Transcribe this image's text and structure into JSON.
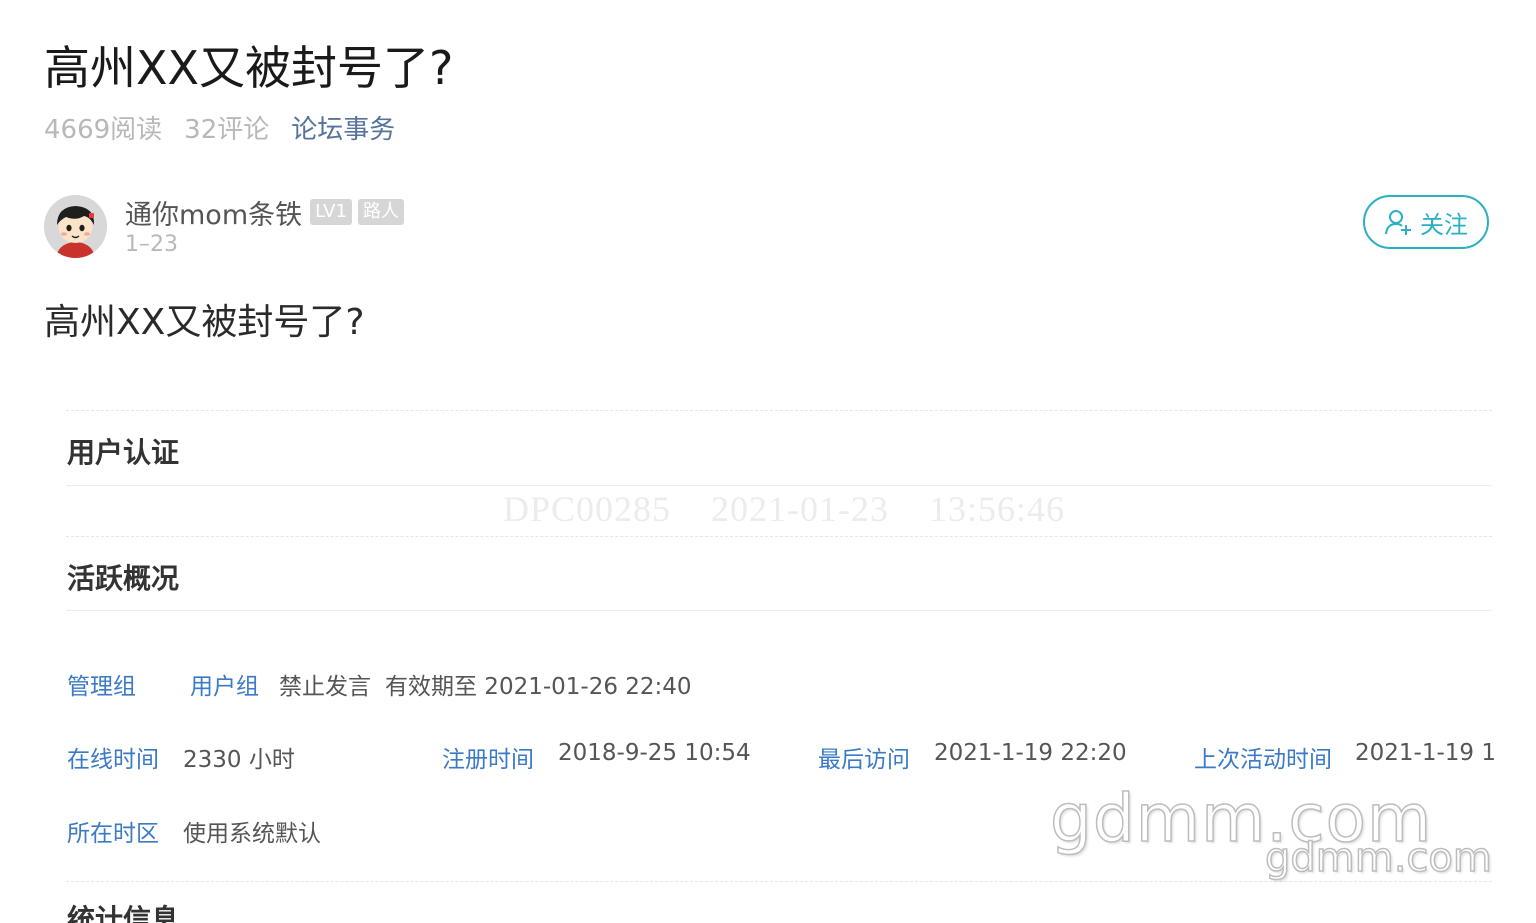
{
  "post": {
    "title": "高州XX又被封号了?",
    "body": "高州XX又被封号了?"
  },
  "meta": {
    "reads": "4669阅读",
    "comments": "32评论",
    "category": "论坛事务"
  },
  "author": {
    "name": "通你mom条铁",
    "level_badge": "LV1",
    "role_badge": "路人",
    "date": "1–23",
    "avatar_icon": "cartoon-avatar-icon"
  },
  "follow": {
    "label": "关注",
    "icon": "add-user-icon",
    "color": "#2ab0c3"
  },
  "screenshot": {
    "section_user_cert": "用户认证",
    "section_activity": "活跃概况",
    "section_stats": "统计信息",
    "watermark": "DPC00285    2021-01-23    13:56:46",
    "admin_group_label": "管理组",
    "user_group_label": "用户组",
    "user_group_value": "禁止发言",
    "valid_until": "有效期至 2021-01-26 22:40",
    "online_time_label": "在线时间",
    "online_time_value": "2330 小时",
    "register_time_label": "注册时间",
    "register_time_value": "2018-9-25 10:54",
    "last_visit_label": "最后访问",
    "last_visit_value": "2021-1-19 22:20",
    "last_active_label": "上次活动时间",
    "last_active_value": "2021-1-19 1",
    "timezone_label": "所在时区",
    "timezone_value": "使用系统默认",
    "link_color": "#3b7ac6"
  },
  "site_watermark": {
    "big": "gdmm.com",
    "small": "gdmm.com"
  }
}
